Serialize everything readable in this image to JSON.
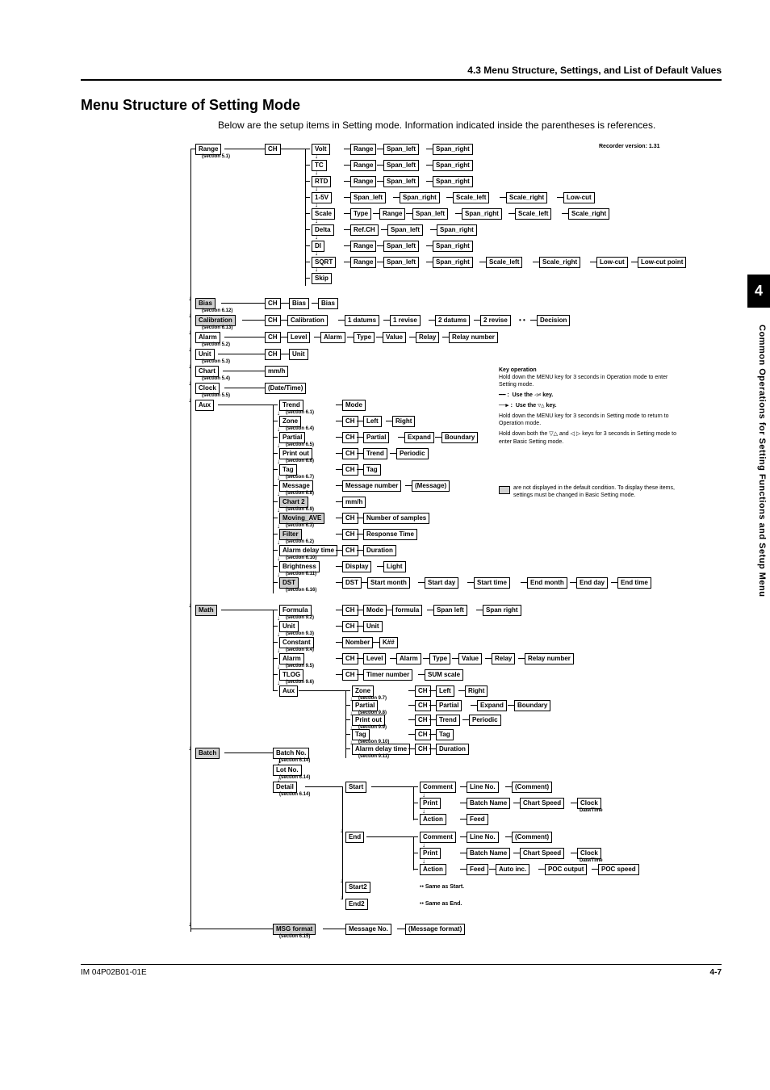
{
  "header": "4.3  Menu Structure, Settings, and List of Default Values",
  "title": "Menu Structure of Setting Mode",
  "intro": "Below are the setup items in Setting mode. Information indicated inside the parentheses is references.",
  "recorder_version": "Recorder version: 1.31",
  "side_tab": "4",
  "side_text": "Common Operations for Setting Functions and Setup Menu",
  "footer_left": "IM 04P02B01-01E",
  "footer_right": "4-7",
  "chart_data": {
    "type": "tree",
    "root_items": [
      {
        "label": "Range",
        "section": "(section 5.1)",
        "child": "CH",
        "grandchildren": [
          {
            "label": "Volt",
            "chain": [
              "Range",
              "Span_left",
              "Span_right"
            ]
          },
          {
            "label": "TC",
            "chain": [
              "Range",
              "Span_left",
              "Span_right"
            ]
          },
          {
            "label": "RTD",
            "chain": [
              "Range",
              "Span_left",
              "Span_right"
            ]
          },
          {
            "label": "1-5V",
            "chain": [
              "Span_left",
              "Span_right",
              "Scale_left",
              "Scale_right",
              "Low-cut"
            ]
          },
          {
            "label": "Scale",
            "chain": [
              "Type",
              "Range",
              "Span_left",
              "Span_right",
              "Scale_left",
              "Scale_right"
            ]
          },
          {
            "label": "Delta",
            "chain": [
              "Ref.CH",
              "Span_left",
              "Span_right"
            ]
          },
          {
            "label": "DI",
            "chain": [
              "Range",
              "Span_left",
              "Span_right"
            ]
          },
          {
            "label": "SQRT",
            "chain": [
              "Range",
              "Span_left",
              "Span_right",
              "Scale_left",
              "Scale_right",
              "Low-cut",
              "Low-cut point"
            ]
          },
          {
            "label": "Skip"
          }
        ]
      },
      {
        "label": "Bias",
        "section": "(section 6.12)",
        "grey": true,
        "child": "CH",
        "chain": [
          "Bias",
          "Bias"
        ]
      },
      {
        "label": "Calibration",
        "section": "(section 6.13)",
        "grey": true,
        "child": "CH",
        "chain": [
          "Calibration",
          "1 datums",
          "1 revise",
          "2 datums",
          "2 revise",
          "Decision"
        ],
        "dots_after_index": 4
      },
      {
        "label": "Alarm",
        "section": "(section 5.2)",
        "child": "CH",
        "chain": [
          "Level",
          "Alarm",
          "Type",
          "Value",
          "Relay",
          "Relay number"
        ]
      },
      {
        "label": "Unit",
        "section": "(section 5.3)",
        "child": "CH",
        "chain": [
          "Unit"
        ]
      },
      {
        "label": "Chart",
        "section": "(section 5.4)",
        "chain": [
          "mm/h"
        ]
      },
      {
        "label": "Clock",
        "section": "(section 5.5)",
        "chain": [
          "(Date/Time)"
        ]
      },
      {
        "label": "Aux",
        "children": [
          {
            "label": "Trend",
            "section": "(section 6.1)",
            "chain": [
              "Mode"
            ]
          },
          {
            "label": "Zone",
            "section": "(section 6.4)",
            "chain": [
              "CH",
              "Left",
              "Right"
            ]
          },
          {
            "label": "Partial",
            "section": "(section 6.5)",
            "chain": [
              "CH",
              "Partial",
              "Expand",
              "Boundary"
            ]
          },
          {
            "label": "Print out",
            "section": "(section 6.6)",
            "chain": [
              "CH",
              "Trend",
              "Periodic"
            ]
          },
          {
            "label": "Tag",
            "section": "(section 6.7)",
            "chain": [
              "CH",
              "Tag"
            ]
          },
          {
            "label": "Message",
            "section": "(section 6.8)",
            "chain": [
              "Message number",
              "(Message)"
            ]
          },
          {
            "label": "Chart 2",
            "section": "(section 6.9)",
            "grey": true,
            "chain": [
              "mm/h"
            ]
          },
          {
            "label": "Moving_AVE",
            "section": "(section 6.3)",
            "grey": true,
            "chain": [
              "CH",
              "Number of samples"
            ]
          },
          {
            "label": "Filter",
            "section": "(section 6.2)",
            "grey": true,
            "chain": [
              "CH",
              "Response Time"
            ]
          },
          {
            "label": "Alarm delay time",
            "section": "(section 6.10)",
            "chain": [
              "CH",
              "Duration"
            ]
          },
          {
            "label": "Brightness",
            "section": "(section 6.11)",
            "chain": [
              "Display",
              "Light"
            ]
          },
          {
            "label": "DST",
            "section": "(section 6.16)",
            "grey": true,
            "chain": [
              "DST",
              "Start month",
              "Start day",
              "Start time",
              "End month",
              "End day",
              "End time"
            ]
          }
        ]
      },
      {
        "label": "Math",
        "grey": true,
        "children": [
          {
            "label": "Formula",
            "section": "(section 9.2)",
            "chain": [
              "CH",
              "Mode",
              "formula",
              "Span left",
              "Span right"
            ]
          },
          {
            "label": "Unit",
            "section": "(section 9.3)",
            "chain": [
              "CH",
              "Unit"
            ]
          },
          {
            "label": "Constant",
            "section": "(section 9.4)",
            "chain": [
              "Nomber",
              "K##"
            ]
          },
          {
            "label": "Alarm",
            "section": "(section 9.5)",
            "chain": [
              "CH",
              "Level",
              "Alarm",
              "Type",
              "Value",
              "Relay",
              "Relay number"
            ]
          },
          {
            "label": "TLOG",
            "section": "(section 9.6)",
            "chain": [
              "CH",
              "Timer number",
              "SUM scale"
            ]
          },
          {
            "label": "Aux",
            "children": [
              {
                "label": "Zone",
                "section": "(section 9.7)",
                "chain": [
                  "CH",
                  "Left",
                  "Right"
                ]
              },
              {
                "label": "Partial",
                "section": "(section 9.8)",
                "chain": [
                  "CH",
                  "Partial",
                  "Expand",
                  "Boundary"
                ]
              },
              {
                "label": "Print out",
                "section": "(section 9.9)",
                "chain": [
                  "CH",
                  "Trend",
                  "Periodic"
                ]
              },
              {
                "label": "Tag",
                "section": "(section 9.10)",
                "chain": [
                  "CH",
                  "Tag"
                ]
              },
              {
                "label": "Alarm delay time",
                "section": "(section 9.11)",
                "chain": [
                  "CH",
                  "Duration"
                ]
              }
            ]
          }
        ]
      },
      {
        "label": "Batch",
        "grey": true,
        "children": [
          {
            "label": "Batch No.",
            "section": "(section 6.14)"
          },
          {
            "label": "Lot No.",
            "section": "(section 6.14)"
          },
          {
            "label": "Detail",
            "section": "(section 6.14)",
            "children": [
              {
                "label": "Start",
                "children": [
                  {
                    "label": "Comment",
                    "chain": [
                      "Line No.",
                      "(Comment)"
                    ]
                  },
                  {
                    "label": "Print",
                    "chain": [
                      "Batch Name",
                      "Chart Speed",
                      "Clock"
                    ],
                    "suffix_note": "Date/Time"
                  },
                  {
                    "label": "Action",
                    "chain": [
                      "Feed"
                    ]
                  }
                ]
              },
              {
                "label": "End",
                "children": [
                  {
                    "label": "Comment",
                    "chain": [
                      "Line No.",
                      "(Comment)"
                    ]
                  },
                  {
                    "label": "Print",
                    "chain": [
                      "Batch Name",
                      "Chart Speed",
                      "Clock"
                    ],
                    "suffix_note": "Date/Time"
                  },
                  {
                    "label": "Action",
                    "chain": [
                      "Feed",
                      "Auto inc.",
                      "POC output",
                      "POC speed"
                    ]
                  }
                ]
              },
              {
                "label": "Start2",
                "note": "Same as Start."
              },
              {
                "label": "End2",
                "note": "Same as End."
              }
            ]
          }
        ]
      },
      {
        "label": "MSG format",
        "section": "(section 6.15)",
        "grey": true,
        "chain": [
          "Message No.",
          "(Message format)"
        ]
      }
    ],
    "key_operation": {
      "title": "Key operation",
      "lines": [
        "Hold down the MENU key for 3 seconds in Operation mode to enter Setting mode.",
        "━━━ :  Use the ◁⏎ key.",
        "──▶ :  Use the ▽△ key.",
        "Hold down the MENU key for 3 seconds in Setting mode to return to Operation mode.",
        "Hold down both the ▽△ and ◁ ▷ keys for 3 seconds in Setting mode to enter Basic Setting mode."
      ],
      "legend": "are not displayed in the default condition. To display these items, settings must be changed in Basic Setting mode."
    }
  }
}
